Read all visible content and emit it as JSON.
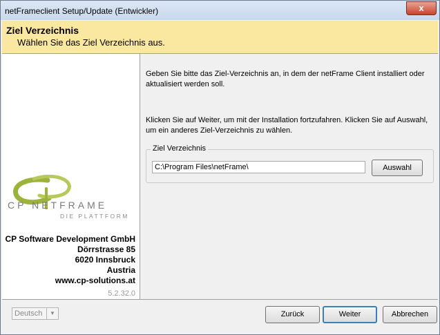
{
  "window": {
    "title": "netFrameclient Setup/Update (Entwickler)",
    "close_label": "x"
  },
  "header": {
    "title": "Ziel Verzeichnis",
    "subtitle": "Wählen Sie das Ziel Verzeichnis aus."
  },
  "content": {
    "paragraph1": "Geben Sie bitte das Ziel-Verzeichnis an, in dem der netFrame Client installiert oder aktualisiert werden soll.",
    "paragraph2": "Klicken Sie auf Weiter, um mit der Installation fortzufahren. Klicken Sie auf Auswahl, um ein anderes Ziel-Verzeichnis zu wählen.",
    "group_label": "Ziel Verzeichnis",
    "path_value": "C:\\Program Files\\netFrame\\",
    "browse_label": "Auswahl"
  },
  "sidebar": {
    "logo_text": "CP NETFRAME",
    "logo_tagline": "DIE PLATTFORM",
    "company_lines": [
      "CP Software Development GmbH",
      "Dörrstrasse 85",
      "6020 Innsbruck",
      "Austria",
      "www.cp-solutions.at"
    ],
    "version": "5.2.32.0"
  },
  "footer": {
    "language": "Deutsch",
    "back_label": "Zurück",
    "next_label": "Weiter",
    "cancel_label": "Abbrechen"
  },
  "colors": {
    "header_bg": "#fbe8a0",
    "logo_green": "#9bb33a",
    "logo_dark": "#7a7a7a",
    "focus_border": "#3c7fb1"
  }
}
